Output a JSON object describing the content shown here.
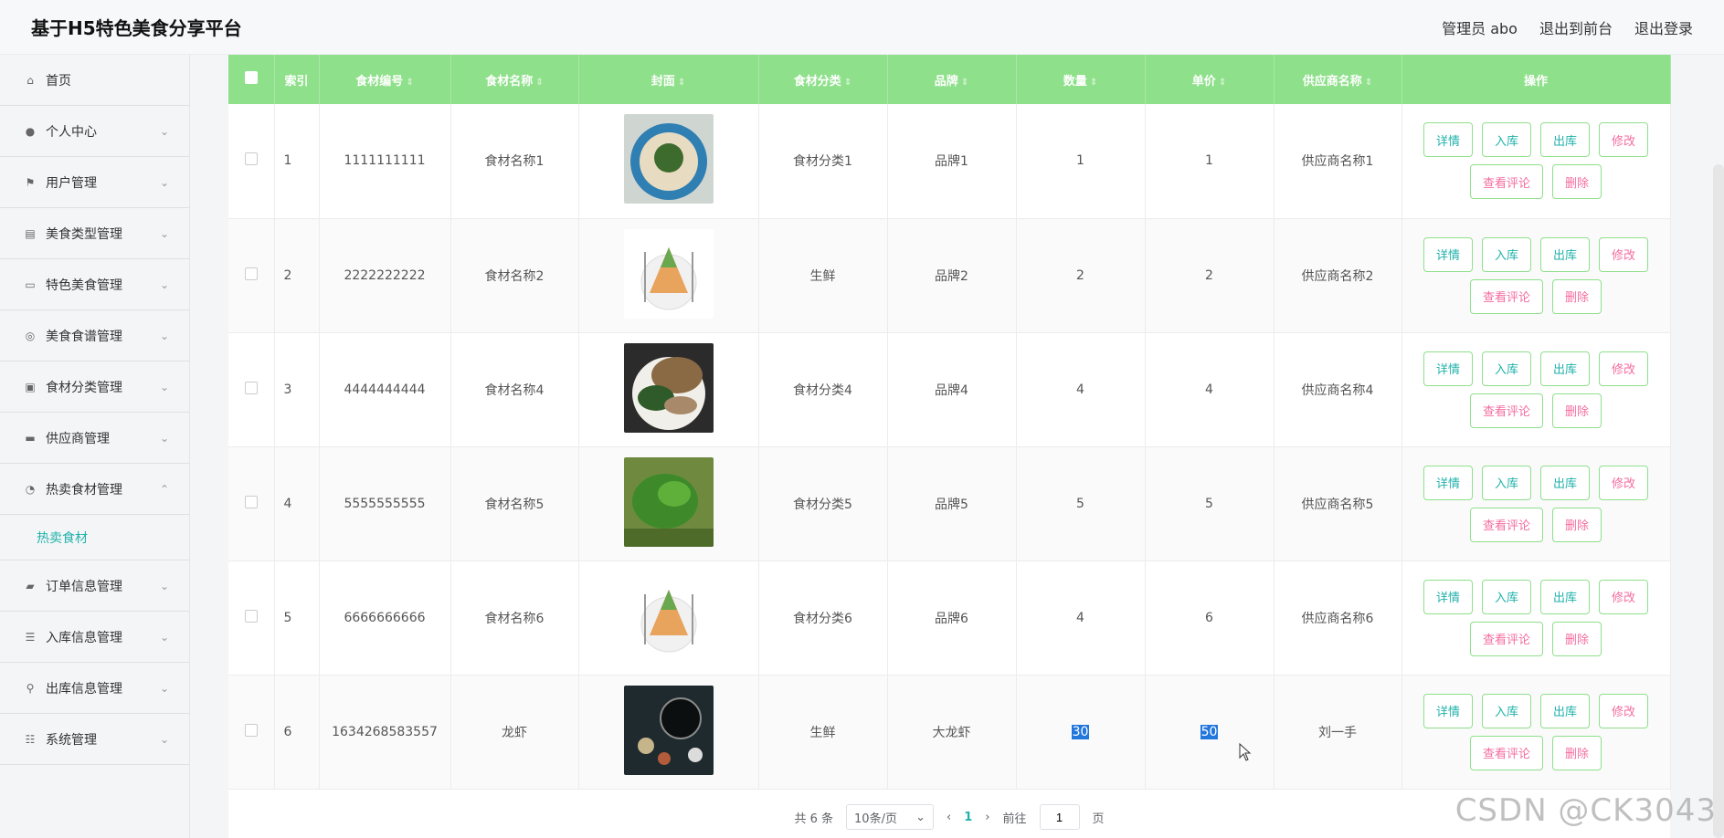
{
  "header": {
    "title": "基于H5特色美食分享平台",
    "admin_label": "管理员 abo",
    "front_label": "退出到前台",
    "logout_label": "退出登录"
  },
  "sidebar": {
    "items": [
      {
        "label": "首页",
        "icon": "home-icon",
        "glyph": "⌂",
        "chevron": ""
      },
      {
        "label": "个人中心",
        "icon": "user-icon",
        "glyph": "●",
        "chevron": "⌄"
      },
      {
        "label": "用户管理",
        "icon": "flag-icon",
        "glyph": "⚑",
        "chevron": "⌄"
      },
      {
        "label": "美食类型管理",
        "icon": "clipboard-icon",
        "glyph": "▤",
        "chevron": "⌄"
      },
      {
        "label": "特色美食管理",
        "icon": "monitor-icon",
        "glyph": "▭",
        "chevron": "⌄"
      },
      {
        "label": "美食食谱管理",
        "icon": "compass-icon",
        "glyph": "◎",
        "chevron": "⌄"
      },
      {
        "label": "食材分类管理",
        "icon": "card-icon",
        "glyph": "▣",
        "chevron": "⌄"
      },
      {
        "label": "供应商管理",
        "icon": "ticket-icon",
        "glyph": "▬",
        "chevron": "⌄"
      },
      {
        "label": "热卖食材管理",
        "icon": "dashboard-icon",
        "glyph": "◔",
        "chevron": "⌃"
      }
    ],
    "submenu_label": "热卖食材",
    "items_after": [
      {
        "label": "订单信息管理",
        "icon": "chat-icon",
        "glyph": "▰",
        "chevron": "⌄"
      },
      {
        "label": "入库信息管理",
        "icon": "list-icon",
        "glyph": "☰",
        "chevron": "⌄"
      },
      {
        "label": "出库信息管理",
        "icon": "mic-icon",
        "glyph": "⚲",
        "chevron": "⌄"
      },
      {
        "label": "系统管理",
        "icon": "sliders-icon",
        "glyph": "☷",
        "chevron": "⌄"
      }
    ]
  },
  "table": {
    "columns": [
      "索引",
      "食材编号",
      "食材名称",
      "封面",
      "食材分类",
      "品牌",
      "数量",
      "单价",
      "供应商名称",
      "操作"
    ],
    "sort_glyph": "⇕",
    "rows": [
      {
        "index": "1",
        "code": "1111111111",
        "name": "食材名称1",
        "category": "食材分类1",
        "brand": "品牌1",
        "qty": "1",
        "price": "1",
        "supplier": "供应商名称1",
        "cover": "noodle-bowl-image"
      },
      {
        "index": "2",
        "code": "2222222222",
        "name": "食材名称2",
        "category": "生鲜",
        "brand": "品牌2",
        "qty": "2",
        "price": "2",
        "supplier": "供应商名称2",
        "cover": "food-pyramid-image"
      },
      {
        "index": "3",
        "code": "4444444444",
        "name": "食材名称4",
        "category": "食材分类4",
        "brand": "品牌4",
        "qty": "4",
        "price": "4",
        "supplier": "供应商名称4",
        "cover": "bread-plate-image"
      },
      {
        "index": "4",
        "code": "5555555555",
        "name": "食材名称5",
        "category": "食材分类5",
        "brand": "品牌5",
        "qty": "5",
        "price": "5",
        "supplier": "供应商名称5",
        "cover": "seaweed-image"
      },
      {
        "index": "5",
        "code": "6666666666",
        "name": "食材名称6",
        "category": "食材分类6",
        "brand": "品牌6",
        "qty": "4",
        "price": "6",
        "supplier": "供应商名称6",
        "cover": "food-pyramid-image"
      },
      {
        "index": "6",
        "code": "1634268583557",
        "name": "龙虾",
        "category": "生鲜",
        "brand": "大龙虾",
        "qty": "30",
        "price": "50",
        "supplier": "刘一手",
        "cover": "dark-table-image"
      }
    ],
    "actions": {
      "detail": "详情",
      "stock_in": "入库",
      "stock_out": "出库",
      "edit": "修改",
      "comments": "查看评论",
      "delete": "删除"
    }
  },
  "pager": {
    "total": "共 6 条",
    "page_size": "10条/页",
    "prev": "‹",
    "current": "1",
    "next": "›",
    "goto_prefix": "前往",
    "goto_value": "1",
    "goto_suffix": "页"
  },
  "watermark": "CSDN @CK3043",
  "colors": {
    "header_green": "#8ee08a",
    "teal": "#20b2aa",
    "pink": "#f56c9f"
  }
}
